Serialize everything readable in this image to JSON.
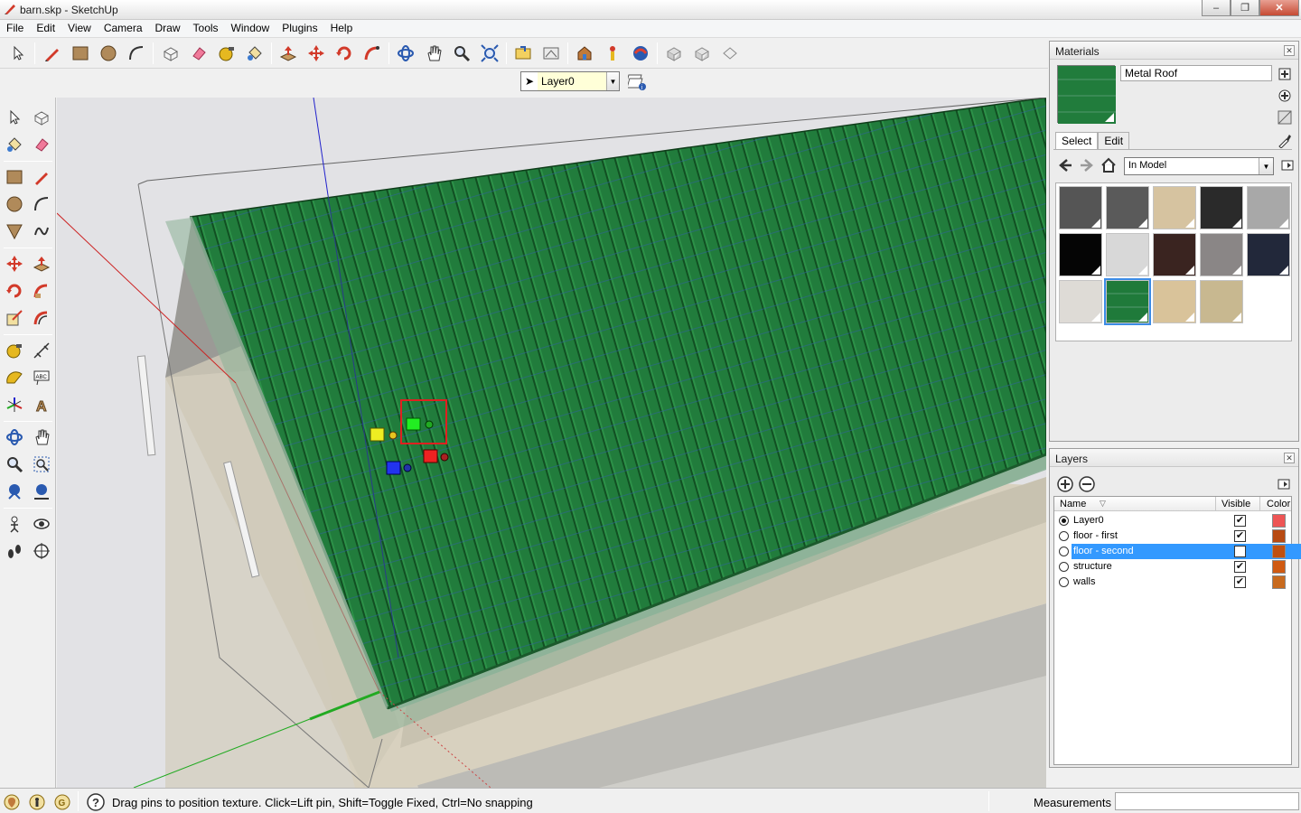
{
  "window": {
    "title": "barn.skp - SketchUp"
  },
  "menu": [
    "File",
    "Edit",
    "View",
    "Camera",
    "Draw",
    "Tools",
    "Window",
    "Plugins",
    "Help"
  ],
  "layer_toolbar": {
    "current_layer": "Layer0"
  },
  "materials_panel": {
    "title": "Materials",
    "material_name": "Metal Roof",
    "tabs": [
      "Select",
      "Edit"
    ],
    "collection": "In Model",
    "swatches": [
      "#555555",
      "#5a5a5a",
      "#d6c3a0",
      "#2a2a2a",
      "#a8a8a8",
      "#050505",
      "#d8d8d8",
      "#3a2420",
      "#8a8686",
      "#22283a",
      "#dedbd6",
      "#1f7a3a",
      "#d9c39a",
      "#c8b890"
    ],
    "selected_swatch": 11
  },
  "layers_panel": {
    "title": "Layers",
    "columns": {
      "name": "Name",
      "visible": "Visible",
      "color": "Color"
    },
    "rows": [
      {
        "name": "Layer0",
        "visible": true,
        "color": "#ee5555",
        "current": true,
        "selected": false
      },
      {
        "name": "floor - first",
        "visible": true,
        "color": "#b84a12",
        "current": false,
        "selected": false
      },
      {
        "name": "floor - second",
        "visible": false,
        "color": "#c05010",
        "current": false,
        "selected": true
      },
      {
        "name": "structure",
        "visible": true,
        "color": "#d05a12",
        "current": false,
        "selected": false
      },
      {
        "name": "walls",
        "visible": true,
        "color": "#c86a1e",
        "current": false,
        "selected": false
      }
    ]
  },
  "status": {
    "hint": "Drag pins to position texture.  Click=Lift pin, Shift=Toggle Fixed, Ctrl=No snapping",
    "measurements_label": "Measurements",
    "measurements_value": ""
  },
  "colors": {
    "roof": "#1f7a3a",
    "selection": "#3399ff",
    "axis_red": "#cc2222",
    "axis_green": "#22aa22",
    "axis_blue": "#2222cc"
  },
  "icons": {
    "toolbar_top": [
      "select-arrow-icon",
      "pencil-icon",
      "rectangle-icon",
      "circle-icon",
      "arc-icon",
      "make-component-icon",
      "eraser-icon",
      "tape-measure-icon",
      "paint-bucket-icon",
      "push-pull-icon",
      "move-icon",
      "rotate-icon",
      "follow-me-icon",
      "orbit-icon",
      "pan-icon",
      "zoom-icon",
      "zoom-extents-icon",
      "previous-view-icon",
      "next-view-icon",
      "warehouse-icon",
      "get-models-icon",
      "share-model-icon",
      "section-plane-icon",
      "display-section-icon",
      "section-cuts-icon"
    ]
  }
}
